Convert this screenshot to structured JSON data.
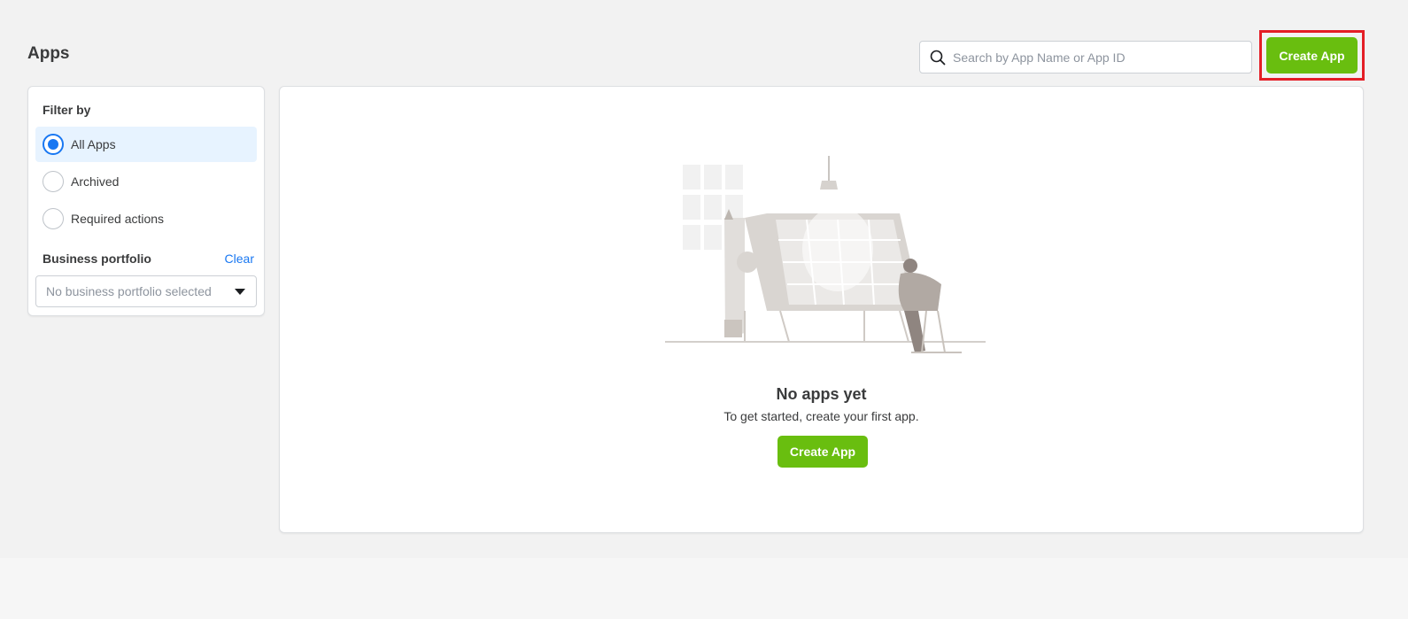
{
  "page": {
    "title": "Apps"
  },
  "search": {
    "placeholder": "Search by App Name or App ID",
    "value": ""
  },
  "header": {
    "create_label": "Create App"
  },
  "filter": {
    "title": "Filter by",
    "options": [
      {
        "label": "All Apps",
        "selected": true
      },
      {
        "label": "Archived",
        "selected": false
      },
      {
        "label": "Required actions",
        "selected": false
      }
    ]
  },
  "business_portfolio": {
    "title": "Business portfolio",
    "clear_label": "Clear",
    "selected": "No business portfolio selected"
  },
  "empty_state": {
    "title": "No apps yet",
    "subtitle": "To get started, create your first app.",
    "button_label": "Create App"
  },
  "colors": {
    "accent_green": "#69be0f",
    "highlight_red": "#e41e26",
    "link_blue": "#1877f2",
    "selected_bg": "#e7f3ff"
  }
}
